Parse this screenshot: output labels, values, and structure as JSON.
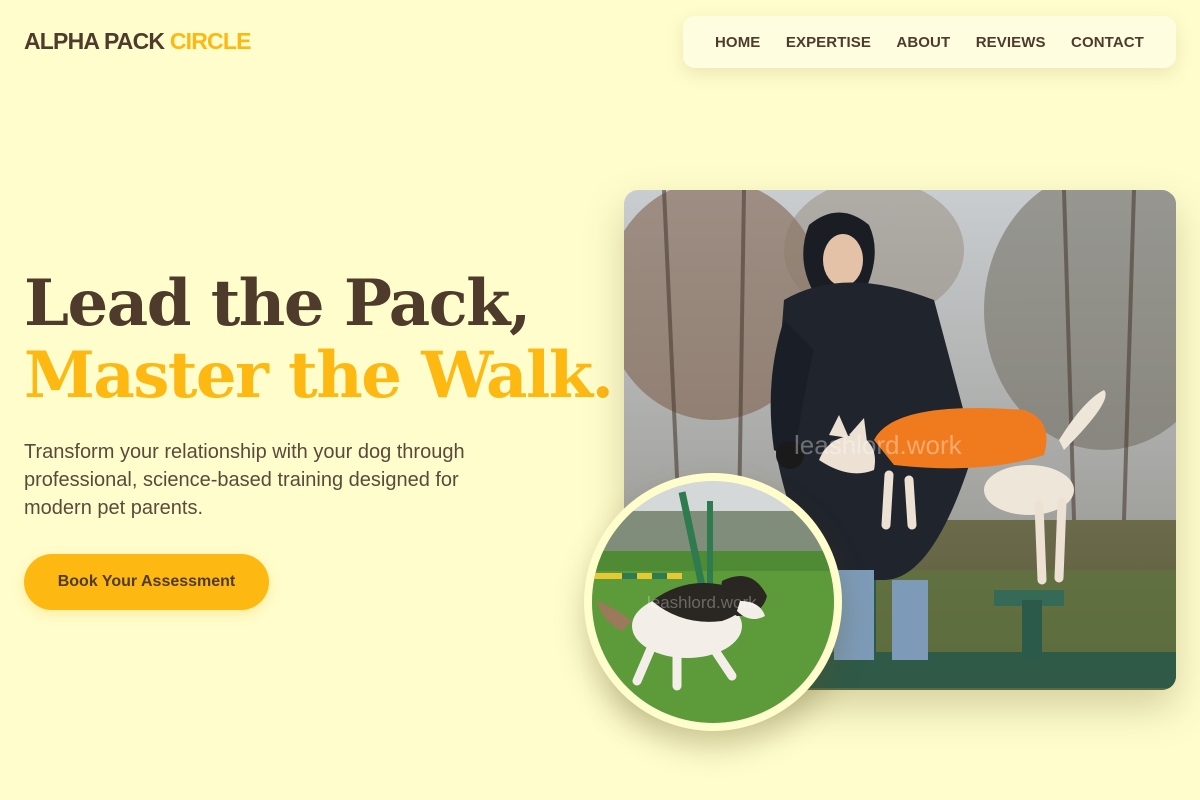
{
  "brand": {
    "name_main": "ALPHA PACK",
    "name_accent": "CIRCLE"
  },
  "nav": {
    "items": [
      "HOME",
      "EXPERTISE",
      "ABOUT",
      "REVIEWS",
      "CONTACT"
    ]
  },
  "hero": {
    "headline_line1": "Lead the Pack,",
    "headline_line2": "Master the Walk.",
    "subtext": "Transform your relationship with your dog through professional, science-based training designed for modern pet parents.",
    "cta_label": "Book Your Assessment"
  },
  "images": {
    "main_watermark": "leashlord.work",
    "round_watermark": "leashlord.work",
    "main_alt": "Trainer in black puffer coat guiding a dog in an orange jacket over agility bench",
    "round_alt": "Tricolor dog running on grass at agility course"
  },
  "colors": {
    "background": "#fffdcc",
    "text": "#4e3b2c",
    "accent": "#fdb812"
  }
}
